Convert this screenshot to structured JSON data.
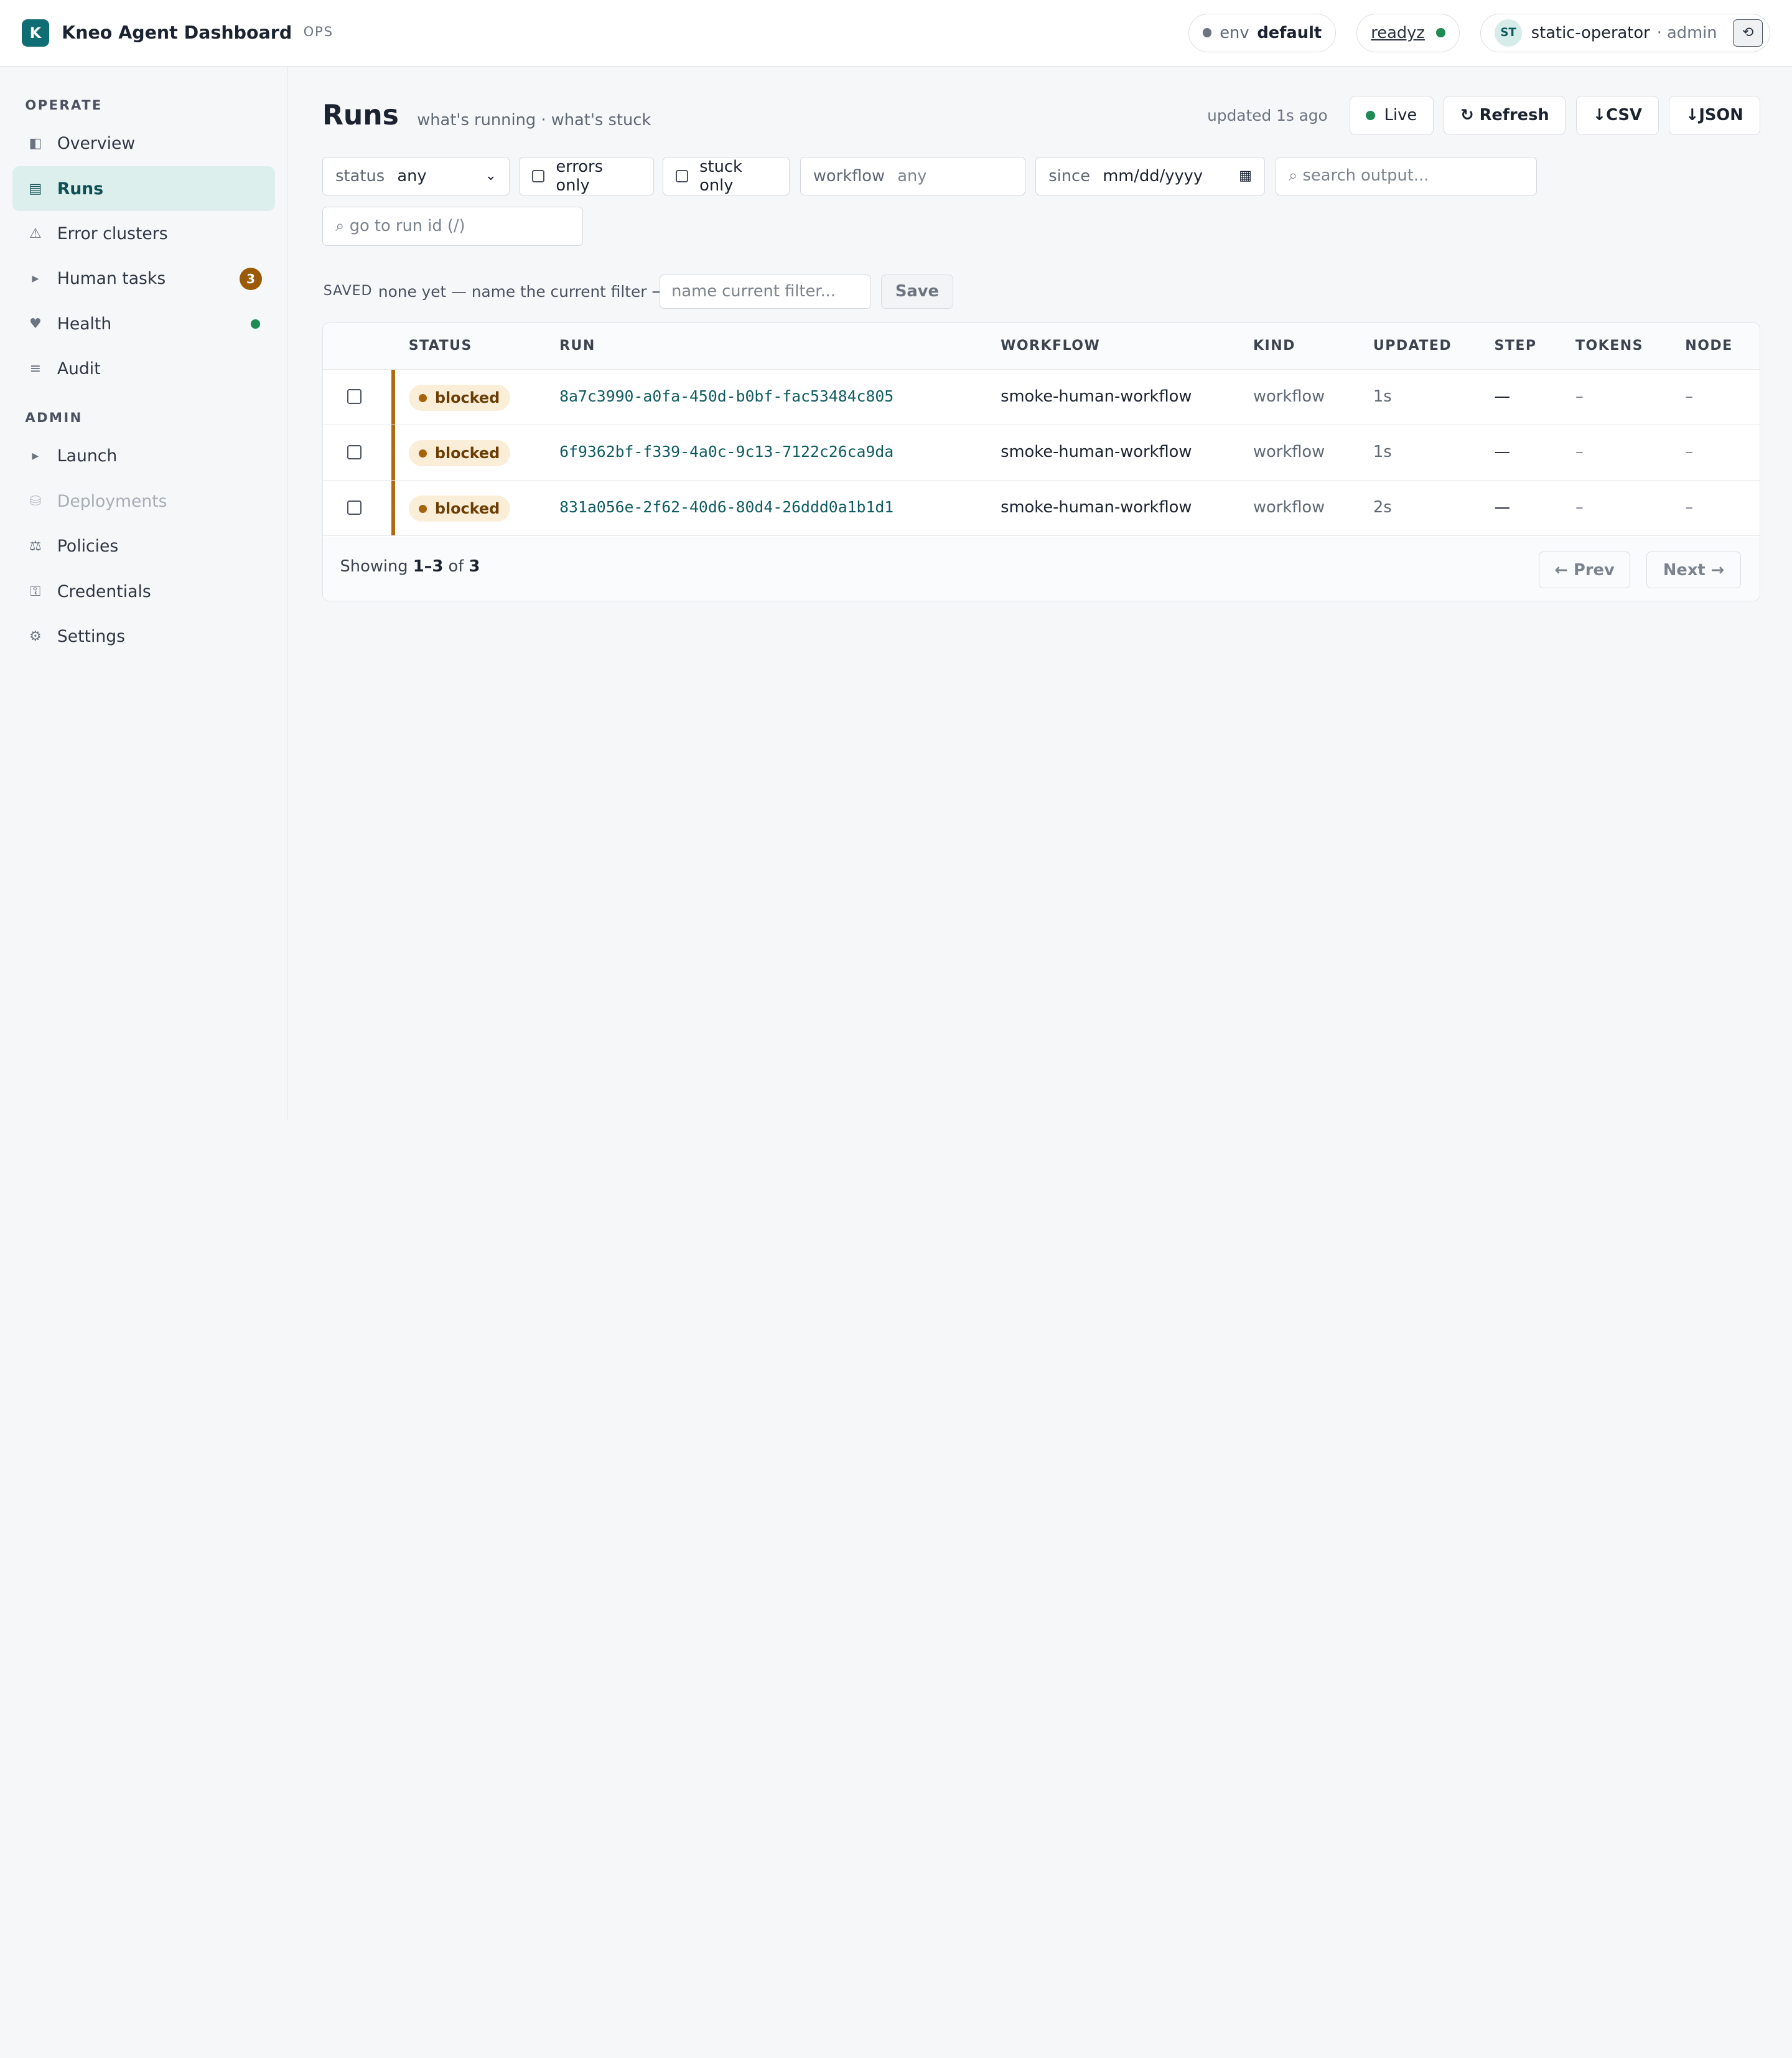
{
  "header": {
    "logo_letter": "K",
    "app_title": "Kneo Agent Dashboard",
    "app_tag": "OPS",
    "env_label": "env",
    "env_value": "default",
    "readyz_label": "readyz",
    "user_initials": "ST",
    "user_name": "static-operator",
    "user_role": "· admin",
    "theme_icon": "⟲"
  },
  "sidebar": {
    "operate_label": "OPERATE",
    "admin_label": "ADMIN",
    "operate_items": [
      {
        "label": "Overview",
        "icon": "◧"
      },
      {
        "label": "Runs",
        "icon": "▤"
      },
      {
        "label": "Error clusters",
        "icon": "⚠"
      },
      {
        "label": "Human tasks",
        "icon": "▸",
        "badge": "3"
      },
      {
        "label": "Health",
        "icon": "♥"
      },
      {
        "label": "Audit",
        "icon": "≡"
      }
    ],
    "admin_items": [
      {
        "label": "Launch",
        "icon": "▸"
      },
      {
        "label": "Deployments",
        "icon": "⛁"
      },
      {
        "label": "Policies",
        "icon": "⚖"
      },
      {
        "label": "Credentials",
        "icon": "⚿"
      },
      {
        "label": "Settings",
        "icon": "⚙"
      }
    ]
  },
  "page": {
    "title": "Runs",
    "subtitle": "what's running · what's stuck",
    "updated_text": "updated 1s ago",
    "live_label": "Live",
    "refresh_label": "↻ Refresh",
    "csv_label": "↓CSV",
    "json_label": "↓JSON"
  },
  "filters": {
    "status_label": "status",
    "status_value": "any",
    "errors_only_label": "errors only",
    "stuck_only_label": "stuck only",
    "workflow_label": "workflow",
    "workflow_placeholder": "any",
    "since_label": "since",
    "since_placeholder": "mm/dd/yyyy",
    "search_placeholder": "⌕ search output...",
    "goto_placeholder": "⌕ go to run id  (/)"
  },
  "saved": {
    "label": "SAVED",
    "text": "none yet — name the current filter →",
    "input_placeholder": "name current filter...",
    "save_label": "Save"
  },
  "table": {
    "columns": [
      "STATUS",
      "RUN",
      "WORKFLOW",
      "KIND",
      "UPDATED",
      "STEP",
      "TOKENS",
      "NODE"
    ],
    "rows": [
      {
        "status": "blocked",
        "run": "8a7c3990-a0fa-450d-b0bf-fac53484c805",
        "workflow": "smoke-human-workflow",
        "kind": "workflow",
        "updated": "1s",
        "step": "—",
        "tokens": "–",
        "node": "–"
      },
      {
        "status": "blocked",
        "run": "6f9362bf-f339-4a0c-9c13-7122c26ca9da",
        "workflow": "smoke-human-workflow",
        "kind": "workflow",
        "updated": "1s",
        "step": "—",
        "tokens": "–",
        "node": "–"
      },
      {
        "status": "blocked",
        "run": "831a056e-2f62-40d6-80d4-26ddd0a1b1d1",
        "workflow": "smoke-human-workflow",
        "kind": "workflow",
        "updated": "2s",
        "step": "—",
        "tokens": "–",
        "node": "–"
      }
    ],
    "showing_prefix": "Showing ",
    "showing_range": "1–3",
    "showing_of": " of ",
    "showing_total": "3",
    "prev_label": "← Prev",
    "next_label": "Next →"
  },
  "colors": {
    "brand": "#0f6e73",
    "active_nav_bg": "#dcefed",
    "blocked_bar": "#b06a10",
    "blocked_pill_bg": "#fbeed8",
    "live_dot": "#1e8a56",
    "badge_bg": "#9a5a08"
  }
}
